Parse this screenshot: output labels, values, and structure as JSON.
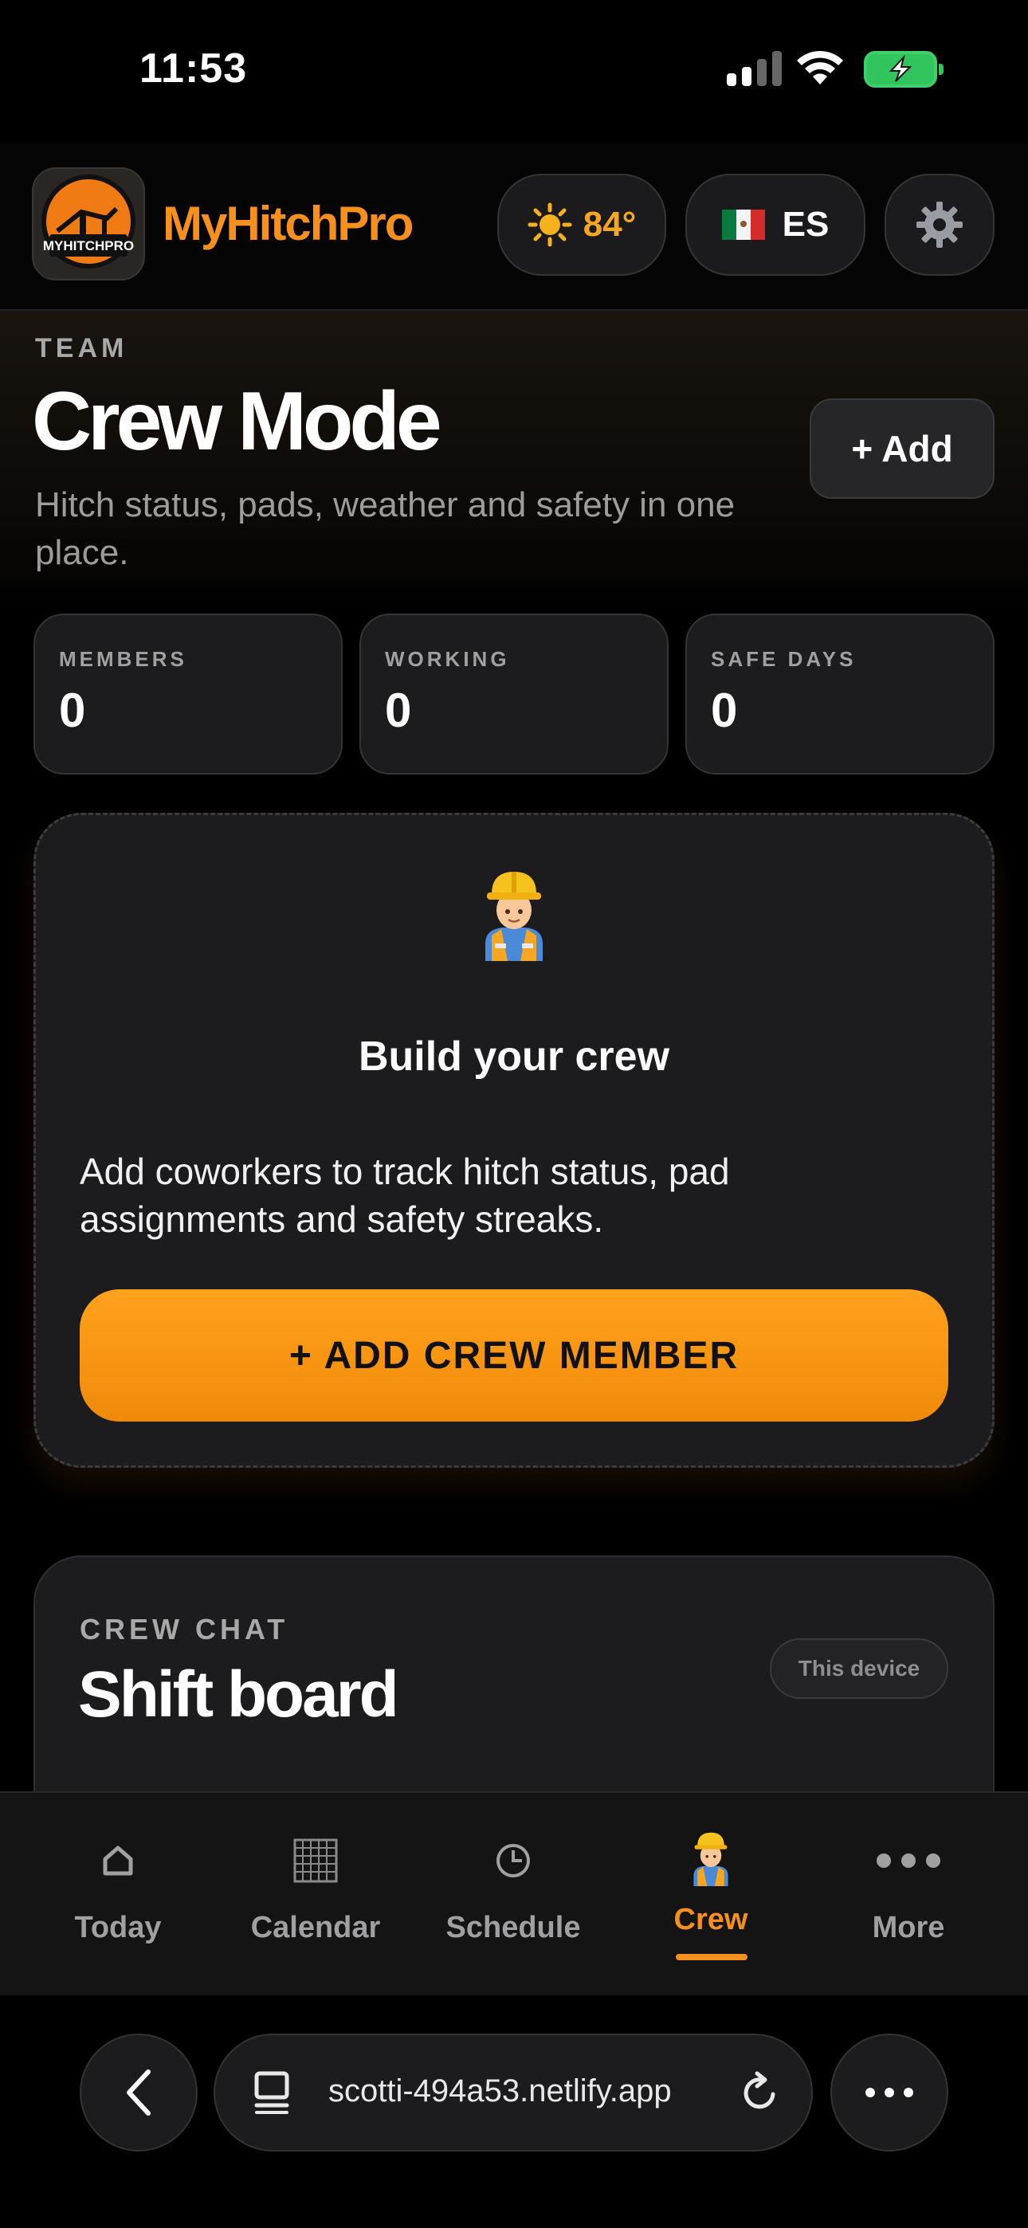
{
  "status_bar": {
    "time": "11:53"
  },
  "header": {
    "app_name": "MyHitchPro",
    "logo_text": "MYHITCHPRO",
    "weather": {
      "icon": "sun-icon",
      "temp": "84°"
    },
    "language": {
      "flag": "🇲🇽",
      "code": "ES"
    },
    "settings_icon": "gear-icon"
  },
  "hero": {
    "eyebrow": "TEAM",
    "title": "Crew Mode",
    "subtitle": "Hitch status, pads, weather and safety in one place.",
    "add_label": "+ Add"
  },
  "stats": [
    {
      "label": "MEMBERS",
      "value": "0"
    },
    {
      "label": "WORKING",
      "value": "0"
    },
    {
      "label": "SAFE DAYS",
      "value": "0"
    }
  ],
  "empty_state": {
    "icon": "construction-worker-icon",
    "title": "Build your crew",
    "text": "Add coworkers to track hitch status, pad assignments and safety streaks.",
    "cta_label": "+ ADD CREW MEMBER"
  },
  "chat": {
    "eyebrow": "CREW CHAT",
    "title": "Shift board",
    "badge": "This device"
  },
  "tabs": [
    {
      "label": "Today",
      "icon": "home-icon"
    },
    {
      "label": "Calendar",
      "icon": "calendar-grid-icon"
    },
    {
      "label": "Schedule",
      "icon": "clock-icon"
    },
    {
      "label": "Crew",
      "icon": "construction-worker-icon",
      "active": true
    },
    {
      "label": "More",
      "icon": "more-dots-icon"
    }
  ],
  "browser": {
    "url": "scotti-494a53.netlify.app"
  },
  "colors": {
    "accent": "#f5901e",
    "background": "#000000",
    "card": "#1c1c1e"
  }
}
